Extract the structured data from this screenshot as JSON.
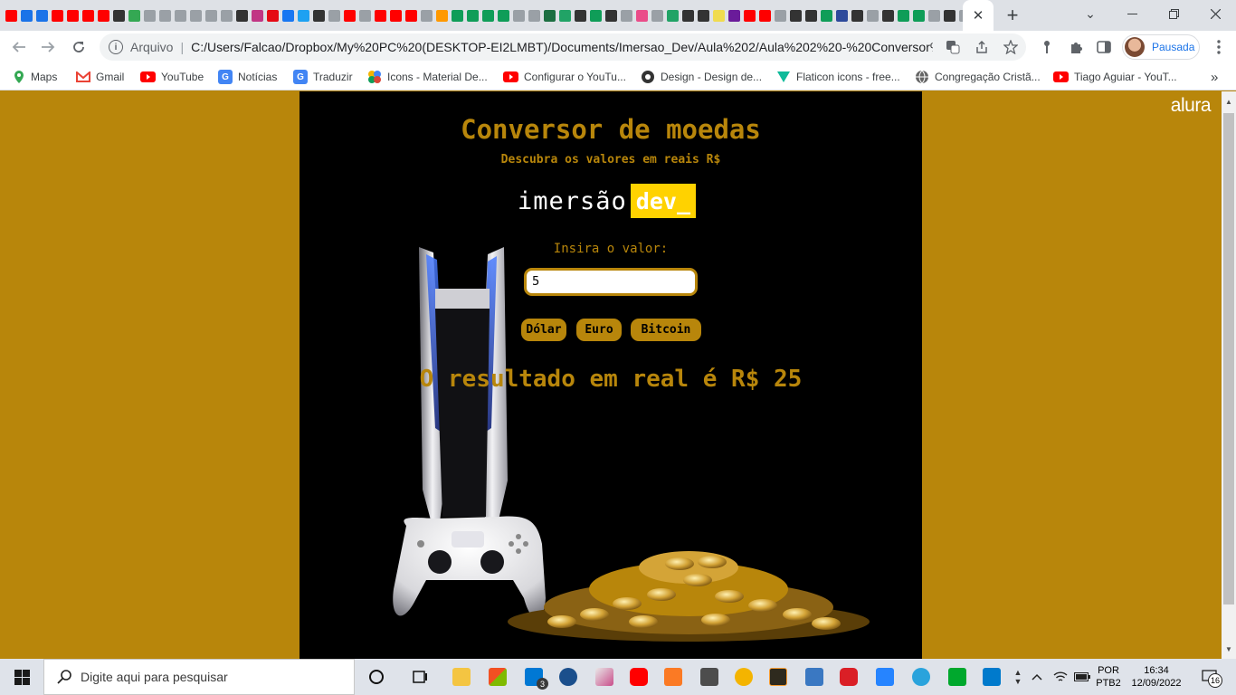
{
  "browser": {
    "tab_favicon_colors": [
      "#ff0000",
      "#1a73e8",
      "#1a73e8",
      "#ff0000",
      "#ff0000",
      "#ff0000",
      "#ff0000",
      "#333333",
      "#34a853",
      "#9aa0a6",
      "#9aa0a6",
      "#9aa0a6",
      "#9aa0a6",
      "#9aa0a6",
      "#9aa0a6",
      "#333333",
      "#c13584",
      "#e50914",
      "#1877f2",
      "#1da1f2",
      "#333333",
      "#9aa0a6",
      "#ff0000",
      "#9aa0a6",
      "#ff0000",
      "#ff0000",
      "#ff0000",
      "#9aa0a6",
      "#ff9900",
      "#0f9d58",
      "#0f9d58",
      "#0f9d58",
      "#0f9d58",
      "#9aa0a6",
      "#9aa0a6",
      "#1d6f42",
      "#21a366",
      "#333333",
      "#0f9d58",
      "#333333",
      "#9aa0a6",
      "#ea4c89",
      "#9aa0a6",
      "#21a366",
      "#333333",
      "#333333",
      "#f0db4f",
      "#6a1b9a",
      "#ff0000",
      "#ff0000",
      "#9aa0a6",
      "#333333",
      "#333333",
      "#0f9d58",
      "#2d4a9b",
      "#333333",
      "#9aa0a6",
      "#333333",
      "#0f9d58",
      "#0f9d58",
      "#9aa0a6",
      "#333333",
      "#9aa0a6"
    ],
    "active_tab_close": "✕",
    "new_tab": "+",
    "window_controls": {
      "minimize_icon": "chevron-down-icon",
      "restore_icon": "restore-icon",
      "close_icon": "close-icon"
    },
    "omnibox": {
      "scheme_label": "Arquivo",
      "url": "C:/Users/Falcao/Dropbox/My%20PC%20(DESKTOP-EI2LMBT)/Documents/Imersao_Dev/Aula%202/Aula%202%20-%20Conversor%20..."
    },
    "profile_label": "Pausada",
    "bookmarks": [
      {
        "label": "Maps",
        "color": "#34a853"
      },
      {
        "label": "Gmail",
        "color": "#ea4335"
      },
      {
        "label": "YouTube",
        "color": "#ff0000"
      },
      {
        "label": "Notícias",
        "color": "#4285f4"
      },
      {
        "label": "Traduzir",
        "color": "#4285f4"
      },
      {
        "label": "Icons - Material De...",
        "color": "#f4b400"
      },
      {
        "label": "Configurar o YouTu...",
        "color": "#ff0000"
      },
      {
        "label": "Design - Design de...",
        "color": "#333333"
      },
      {
        "label": "Flaticon icons - free...",
        "color": "#0fba9a"
      },
      {
        "label": "Congregação Cristã...",
        "color": "#666666"
      },
      {
        "label": "Tiago Aguiar - YouT...",
        "color": "#ff0000"
      }
    ],
    "bookmarks_more": "»"
  },
  "page": {
    "brand": "alura",
    "title": "Conversor de moedas",
    "subtitle": "Descubra os valores em reais R$",
    "logo": {
      "main": "imersão",
      "accent": "dev_"
    },
    "input_label": "Insira o valor:",
    "input_value": "5",
    "buttons": {
      "dollar": "Dólar",
      "euro": "Euro",
      "bitcoin": "Bitcoin"
    },
    "result": "O resultado em real é R$ 25",
    "colors": {
      "accent": "#b8860b",
      "panel": "#000000",
      "dev_badge": "#ffd200"
    }
  },
  "taskbar": {
    "search_placeholder": "Digite aqui para pesquisar",
    "mail_badge": "3",
    "language": "POR",
    "keyboard": "PTB2",
    "time": "16:34",
    "date": "12/09/2022",
    "notification_count": "16"
  }
}
